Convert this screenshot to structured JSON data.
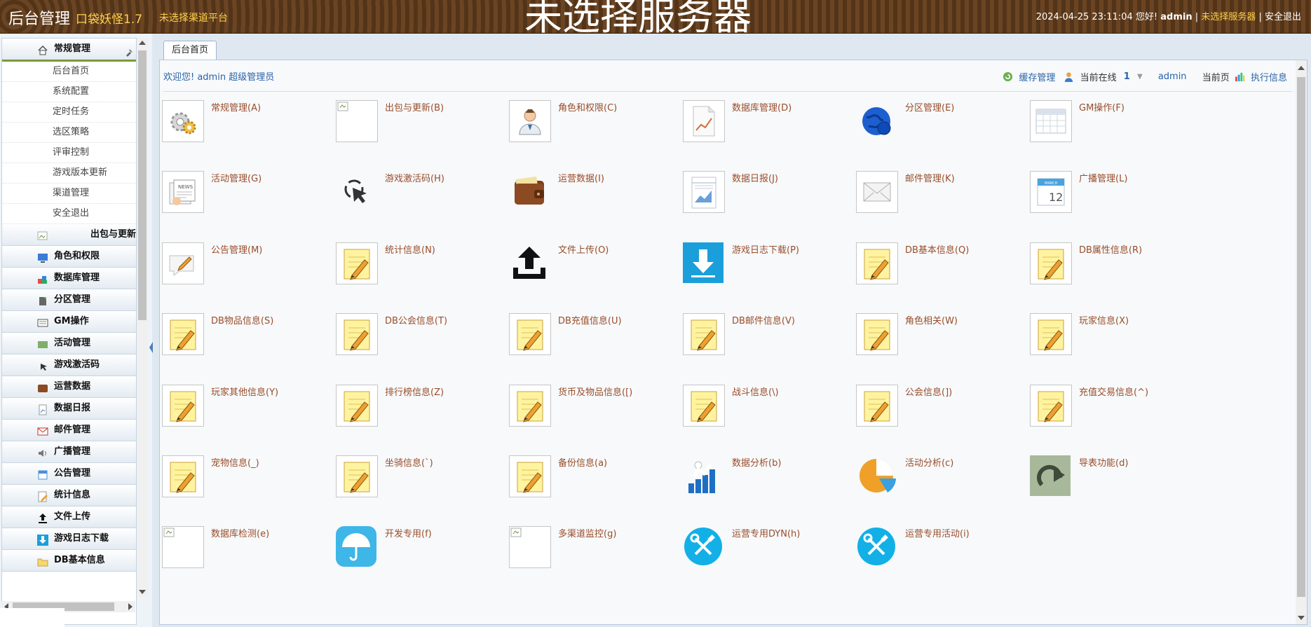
{
  "header": {
    "brand": "后台管理",
    "version": "口袋妖怪1.7",
    "channel": "未选择渠道平台",
    "server": "未选择服务器",
    "datetime": "2024-04-25 23:11:04",
    "greeting": "您好!",
    "user": "admin",
    "server_link": "未选择服务器",
    "logout": "安全退出"
  },
  "sidebar": {
    "groups": [
      {
        "label": "常规管理",
        "icon": "home-icon",
        "items": [
          "后台首页",
          "系统配置",
          "定时任务",
          "选区策略",
          "评审控制",
          "游戏版本更新",
          "渠道管理",
          "安全退出"
        ]
      },
      {
        "label": "出包与更新",
        "icon": "broken-image-icon"
      },
      {
        "label": "角色和权限",
        "icon": "monitor-icon"
      },
      {
        "label": "数据库管理",
        "icon": "database-icon"
      },
      {
        "label": "分区管理",
        "icon": "partition-icon"
      },
      {
        "label": "GM操作",
        "icon": "gm-icon"
      },
      {
        "label": "活动管理",
        "icon": "activity-icon"
      },
      {
        "label": "游戏激活码",
        "icon": "cursor-icon"
      },
      {
        "label": "运营数据",
        "icon": "wallet-icon"
      },
      {
        "label": "数据日报",
        "icon": "report-icon"
      },
      {
        "label": "邮件管理",
        "icon": "mail-icon"
      },
      {
        "label": "广播管理",
        "icon": "speaker-icon"
      },
      {
        "label": "公告管理",
        "icon": "notice-icon"
      },
      {
        "label": "统计信息",
        "icon": "note-icon"
      },
      {
        "label": "文件上传",
        "icon": "upload-icon"
      },
      {
        "label": "游戏日志下载",
        "icon": "download-icon"
      },
      {
        "label": "DB基本信息",
        "icon": "folder-icon"
      }
    ]
  },
  "main": {
    "tab": "后台首页",
    "welcome": "欢迎您!  admin 超级管理员",
    "cache": "缓存管理",
    "online_label": "当前在线",
    "online_count": "1",
    "admin": "admin",
    "current_page": "当前页",
    "exec_info": "执行信息",
    "tiles": [
      {
        "label": "常规管理(A)",
        "icon": "gears-icon"
      },
      {
        "label": "出包与更新(B)",
        "icon": "broken-image-icon"
      },
      {
        "label": "角色和权限(C)",
        "icon": "person-icon"
      },
      {
        "label": "数据库管理(D)",
        "icon": "chart-doc-icon"
      },
      {
        "label": "分区管理(E)",
        "icon": "globe-icon"
      },
      {
        "label": "GM操作(F)",
        "icon": "calendar-grid-icon"
      },
      {
        "label": "活动管理(G)",
        "icon": "newspaper-icon"
      },
      {
        "label": "游戏激活码(H)",
        "icon": "cursor-click-icon"
      },
      {
        "label": "运营数据(I)",
        "icon": "wallet-icon"
      },
      {
        "label": "数据日报(J)",
        "icon": "report-chart-icon"
      },
      {
        "label": "邮件管理(K)",
        "icon": "envelope-icon"
      },
      {
        "label": "广播管理(L)",
        "icon": "calendar-12-icon"
      },
      {
        "label": "公告管理(M)",
        "icon": "speech-note-icon"
      },
      {
        "label": "统计信息(N)",
        "icon": "note-pencil-icon"
      },
      {
        "label": "文件上传(O)",
        "icon": "upload-icon"
      },
      {
        "label": "游戏日志下载(P)",
        "icon": "download-icon"
      },
      {
        "label": "DB基本信息(Q)",
        "icon": "note-pencil-icon"
      },
      {
        "label": "DB属性信息(R)",
        "icon": "note-pencil-icon"
      },
      {
        "label": "DB物品信息(S)",
        "icon": "note-pencil-icon"
      },
      {
        "label": "DB公会信息(T)",
        "icon": "note-pencil-icon"
      },
      {
        "label": "DB充值信息(U)",
        "icon": "note-pencil-icon"
      },
      {
        "label": "DB邮件信息(V)",
        "icon": "note-pencil-icon"
      },
      {
        "label": "角色相关(W)",
        "icon": "note-pencil-icon"
      },
      {
        "label": "玩家信息(X)",
        "icon": "note-pencil-icon"
      },
      {
        "label": "玩家其他信息(Y)",
        "icon": "note-pencil-icon"
      },
      {
        "label": "排行榜信息(Z)",
        "icon": "note-pencil-icon"
      },
      {
        "label": "货币及物品信息([)",
        "icon": "note-pencil-icon"
      },
      {
        "label": "战斗信息(\\)",
        "icon": "note-pencil-icon"
      },
      {
        "label": "公会信息(])",
        "icon": "note-pencil-icon"
      },
      {
        "label": "充值交易信息(^)",
        "icon": "note-pencil-icon"
      },
      {
        "label": "宠物信息(_)",
        "icon": "note-pencil-icon"
      },
      {
        "label": "坐骑信息(`)",
        "icon": "note-pencil-icon"
      },
      {
        "label": "备份信息(a)",
        "icon": "note-pencil-icon"
      },
      {
        "label": "数据分析(b)",
        "icon": "bar-growth-icon"
      },
      {
        "label": "活动分析(c)",
        "icon": "pie-icon"
      },
      {
        "label": "导表功能(d)",
        "icon": "export-arrow-icon"
      },
      {
        "label": "数据库检测(e)",
        "icon": "broken-image-icon"
      },
      {
        "label": "开发专用(f)",
        "icon": "umbrella-icon"
      },
      {
        "label": "多渠道监控(g)",
        "icon": "broken-image-icon"
      },
      {
        "label": "运营专用DYN(h)",
        "icon": "tools-circle-icon"
      },
      {
        "label": "运营专用活动(i)",
        "icon": "tools-circle-icon"
      }
    ]
  },
  "colors": {
    "header_bg": "#5a3a1c",
    "accent_yellow": "#ffd24a",
    "link_blue": "#2a63a8",
    "tile_label": "#9a4d2a"
  }
}
